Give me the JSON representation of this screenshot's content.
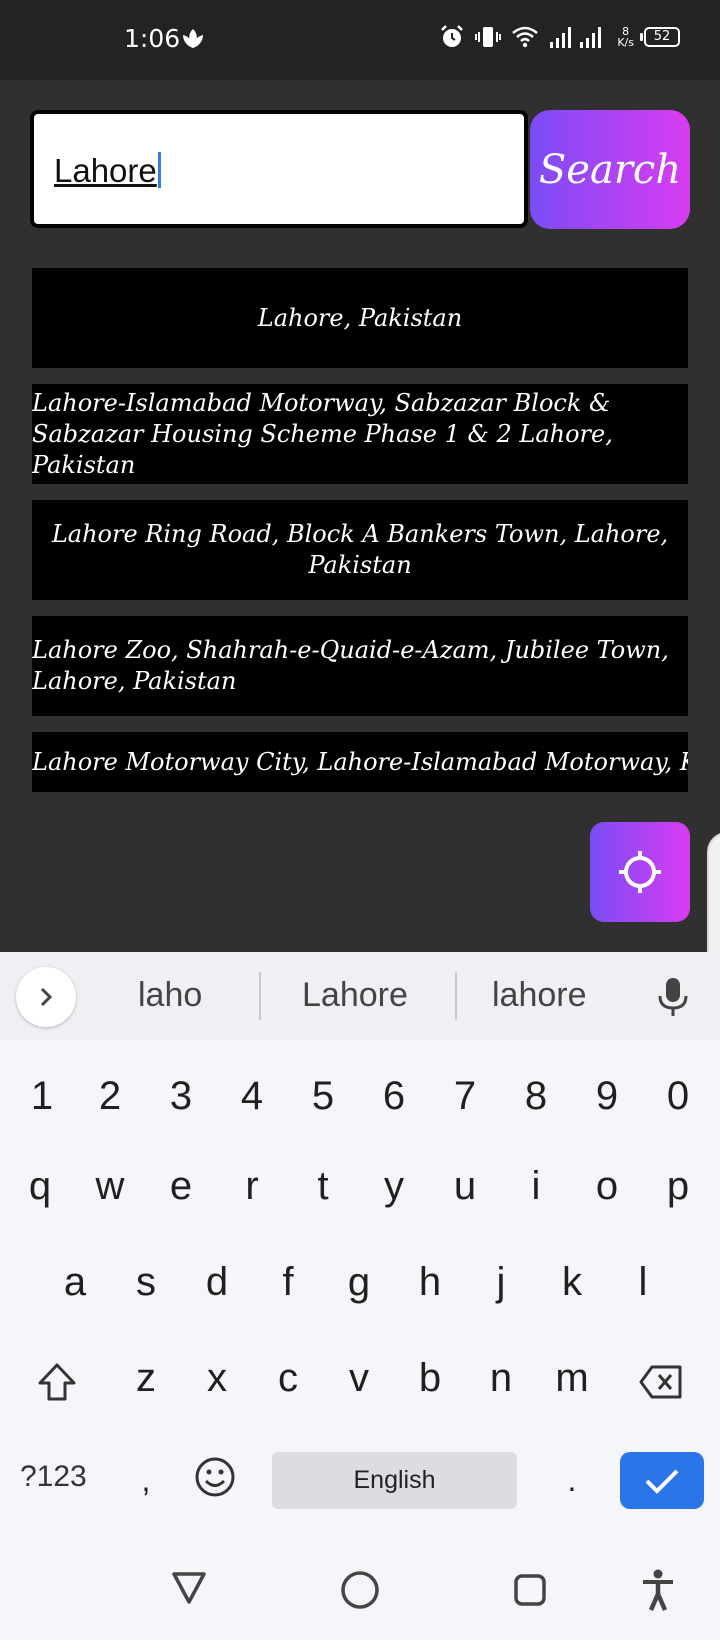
{
  "status_bar": {
    "time": "1:06",
    "net_speed_value": "8",
    "net_speed_unit": "K/s",
    "battery": "52"
  },
  "search": {
    "query": "Lahore",
    "button_label": "Search"
  },
  "suggestions": [
    "Lahore, Pakistan",
    "Lahore-Islamabad Motorway, Sabzazar Block & Sabzazar Housing Scheme Phase 1 & 2 Lahore, Pakistan",
    "Lahore Ring Road, Block A Bankers Town, Lahore, Pakistan",
    "Lahore Zoo, Shahrah-e-Quaid-e-Azam, Jubilee Town, Lahore, Pakistan",
    "Lahore Motorway City, Lahore-Islamabad Motorway, Kot Abdul"
  ],
  "keyboard": {
    "suggestions": [
      "laho",
      "Lahore",
      "lahore"
    ],
    "row_numbers": [
      "1",
      "2",
      "3",
      "4",
      "5",
      "6",
      "7",
      "8",
      "9",
      "0"
    ],
    "row_top": [
      "q",
      "w",
      "e",
      "r",
      "t",
      "y",
      "u",
      "i",
      "o",
      "p"
    ],
    "row_middle": [
      "a",
      "s",
      "d",
      "f",
      "g",
      "h",
      "j",
      "k",
      "l"
    ],
    "row_bottom": [
      "z",
      "x",
      "c",
      "v",
      "b",
      "n",
      "m"
    ],
    "symbols_label": "?123",
    "comma": ",",
    "space_label": "English",
    "period": "."
  },
  "colors": {
    "accent_gradient_start": "#7b4cf5",
    "accent_gradient_end": "#d93cf2",
    "enter_key": "#2a76e8",
    "background": "#303030"
  },
  "icons": [
    "leaf-icon",
    "alarm-icon",
    "vibrate-icon",
    "wifi-icon",
    "signal-icon",
    "battery-icon",
    "crosshair-icon",
    "chevron-right-icon",
    "mic-icon",
    "shift-icon",
    "backspace-icon",
    "emoji-icon",
    "check-icon",
    "back-triangle-icon",
    "home-circle-icon",
    "recents-square-icon",
    "accessibility-icon"
  ]
}
